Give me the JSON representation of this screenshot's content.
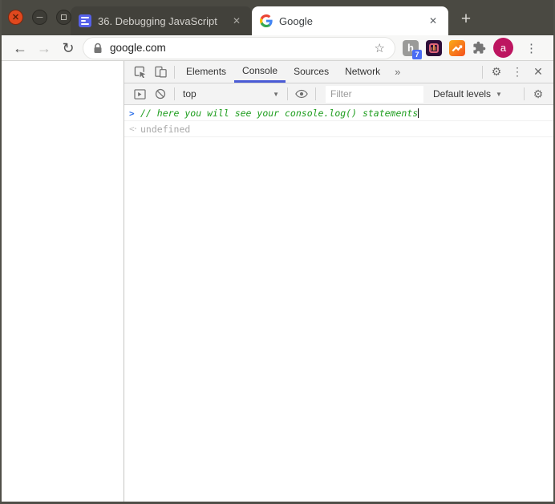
{
  "titlebar": {
    "controls": {
      "close": "✕",
      "minimize": "─",
      "maximize": ""
    },
    "tabs": [
      {
        "title": "36. Debugging JavaScript",
        "favicon": "purple-list-document",
        "close": "✕",
        "active": false
      },
      {
        "title": "Google",
        "favicon": "google-g",
        "close": "✕",
        "active": true
      }
    ],
    "new_tab": "+"
  },
  "toolbar": {
    "back": "←",
    "forward": "→",
    "reload": "↻",
    "omnibox": {
      "url": "google.com",
      "star": "☆"
    },
    "extensions": [
      {
        "name": "h-extension",
        "label": "h",
        "badge": "7"
      },
      {
        "name": "purple-bars-extension"
      },
      {
        "name": "orange-trend-extension"
      }
    ],
    "avatar_letter": "a",
    "menu": "⋮"
  },
  "devtools": {
    "tabs": [
      {
        "label": "Elements"
      },
      {
        "label": "Console"
      },
      {
        "label": "Sources"
      },
      {
        "label": "Network"
      }
    ],
    "active_tab": "Console",
    "more_tabs": "»",
    "topbar": {
      "settings": "⚙",
      "menu": "⋮",
      "close": "✕"
    },
    "console_toolbar": {
      "context": "top",
      "dropdown_arrow": "▼",
      "filter_placeholder": "Filter",
      "levels": "Default levels",
      "settings": "⚙"
    },
    "console": {
      "prompt_symbol": ">",
      "input_text": "// here you will see your console.log() statements",
      "result_symbol": "<·",
      "result_text": "undefined"
    }
  },
  "colors": {
    "titlebar_bg": "#4a4942",
    "close_button": "#e0481e",
    "active_tab_bg": "#ffffff",
    "devtools_accent_underline": "#4a5bd6",
    "prompt_blue": "#2c6fe8",
    "comment_green": "#1d9d1d",
    "avatar_pink": "#bd1560",
    "badge_blue": "#4a6cf5"
  }
}
